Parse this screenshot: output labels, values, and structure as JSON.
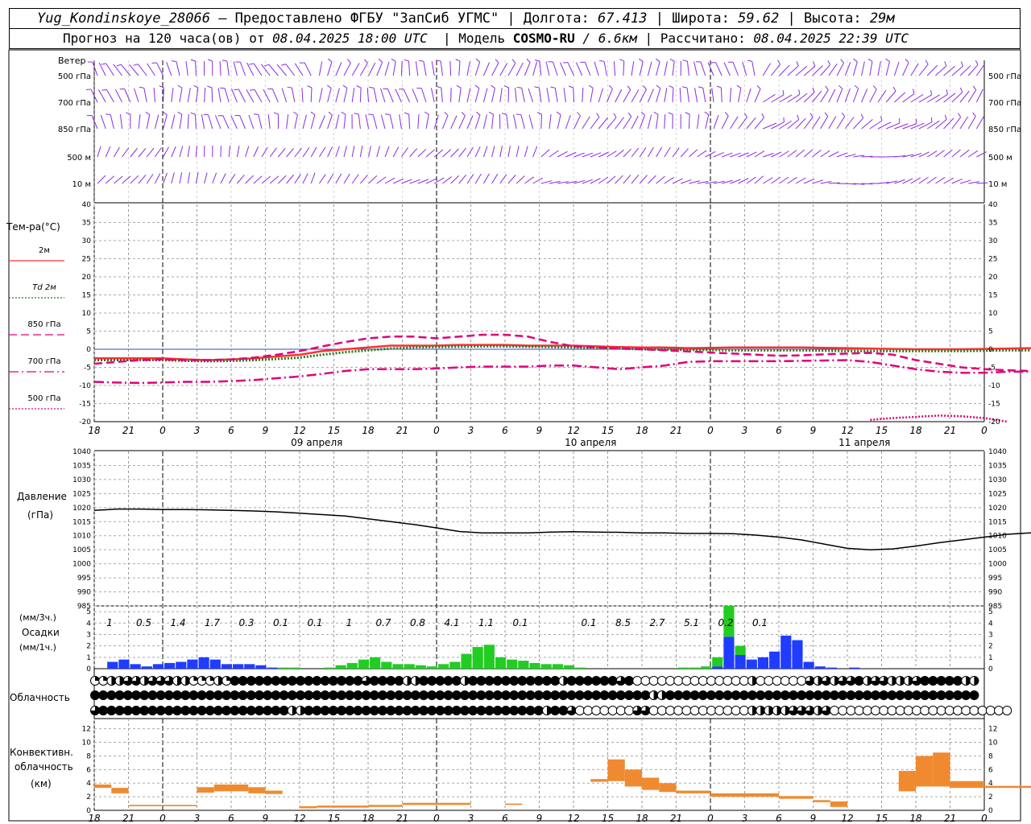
{
  "header": {
    "station": "Yug_Kondinskoye_28066",
    "provider": "– Предоставлено ФГБУ \"ЗапСиб УГМС\"",
    "lon_label": "Долгота:",
    "lon_value": "67.413",
    "lat_label": "Широта:",
    "lat_value": "59.62",
    "alt_label": "Высота:",
    "alt_value": "29м",
    "forecast_label": "Прогноз на 120 часа(ов) от",
    "forecast_start": "08.04.2025 18:00 UTC",
    "model_label": "Модель",
    "model_name": "COSMO-RU",
    "model_res": "/ 6.6км",
    "calc_label": "Рассчитано:",
    "calc_time": "08.04.2025 22:39 UTC"
  },
  "chart_data": {
    "x_ticks": [
      "18",
      "21",
      "0",
      "3",
      "6",
      "9",
      "12",
      "15",
      "18",
      "21",
      "0",
      "3",
      "6",
      "9",
      "12",
      "15",
      "18",
      "21",
      "0",
      "3",
      "6",
      "9",
      "12",
      "15",
      "18",
      "21",
      "0"
    ],
    "day_labels": [
      "09 апреля",
      "10 апреля",
      "11 апреля"
    ],
    "wind": {
      "title": "Ветер",
      "levels": [
        "500 гПа",
        "700 гПа",
        "850 гПа",
        "500 м",
        "10 м"
      ],
      "color": "#8a2be2"
    },
    "temperature": {
      "title": "Тем-ра(°С)",
      "type": "line",
      "ylim": [
        -20,
        40
      ],
      "y_ticks": [
        40,
        35,
        30,
        25,
        20,
        15,
        10,
        5,
        0,
        -5,
        -10,
        -15,
        -20
      ],
      "series": [
        {
          "name": "2м",
          "color": "#ff3030",
          "style": "solid",
          "values": [
            -2.5,
            -2.5,
            -2.5,
            -2.5,
            -2.8,
            -3,
            -2.8,
            -2.5,
            -2,
            -1.5,
            -0.5,
            0,
            0.5,
            1,
            1,
            1,
            1.2,
            1.2,
            1.2,
            1,
            1,
            1,
            0.8,
            0.6,
            0.5,
            0.5,
            0.3,
            0.4,
            0.5,
            0.5,
            0.5,
            0.5,
            0.4,
            0.3,
            0.2,
            0.1,
            0,
            0,
            0,
            0.1,
            0.2,
            0.3,
            0.3,
            0.3,
            0.4,
            0.4,
            0.4,
            0.5,
            0.5,
            0.3,
            -0.5,
            -1,
            -1.2,
            -1.3,
            -1.4
          ]
        },
        {
          "name": "Td 2м",
          "color": "#1f7a1f",
          "style": "dotted",
          "values": [
            -3,
            -3,
            -3,
            -3,
            -3.2,
            -3.3,
            -3.2,
            -3,
            -2.7,
            -2.3,
            -1.5,
            -0.8,
            -0.3,
            0.2,
            0.5,
            0.6,
            0.7,
            0.8,
            0.8,
            0.7,
            0.6,
            0.5,
            0.3,
            0.2,
            0,
            -0.1,
            -0.2,
            -0.2,
            -0.3,
            -0.3,
            -0.3,
            -0.3,
            -0.4,
            -0.5,
            -0.5,
            -0.5,
            -0.5,
            -0.5,
            -0.5,
            -0.4,
            -0.3,
            -0.3,
            -0.3,
            -0.2,
            -0.2,
            -0.2,
            -0.2,
            -0.2,
            -0.2,
            -0.5,
            -1.2,
            -1.8,
            -2,
            -2.3,
            -2.5
          ]
        },
        {
          "name": "850 гПа",
          "color": "#e0007a",
          "style": "dash",
          "values": [
            -4,
            -3.5,
            -3,
            -2.8,
            -3,
            -3,
            -2.8,
            -2.3,
            -1.5,
            -0.5,
            0.8,
            2,
            3,
            3.5,
            3.5,
            3,
            3.5,
            4,
            4,
            3.5,
            2,
            0.8,
            0.5,
            0.2,
            0,
            -0.3,
            -0.6,
            -0.9,
            -1.2,
            -1.5,
            -1.8,
            -1.7,
            -1.4,
            -1.2,
            -1,
            -1.5,
            -3,
            -4,
            -5,
            -5.5,
            -5.8,
            -6,
            -6.2,
            -6.2,
            -6.3,
            -6.4,
            -6.6,
            -6.8,
            -7,
            -6.8,
            -6.8,
            -7,
            -7,
            -7.2,
            -7.5
          ]
        },
        {
          "name": "700 гПа",
          "color": "#e0007a",
          "style": "dashdot",
          "values": [
            -9,
            -9.2,
            -9.3,
            -9.2,
            -9,
            -9,
            -8.8,
            -8.5,
            -8,
            -7.5,
            -6.8,
            -6,
            -5.5,
            -5.5,
            -5.5,
            -5.3,
            -5,
            -4.8,
            -4.8,
            -4.8,
            -4.5,
            -4.5,
            -5,
            -5.5,
            -5,
            -4.5,
            -3.5,
            -3.3,
            -3.3,
            -3.3,
            -3.3,
            -3.2,
            -3.1,
            -3,
            -3.5,
            -4.5,
            -5.5,
            -6.2,
            -6.5,
            -6.5,
            -6.2,
            -6.2,
            -6.5,
            -7,
            -7.5,
            -8,
            -8.5,
            -9,
            -9.5,
            -9.8,
            -10.2,
            -10.8,
            -10.2,
            -9.8,
            -10
          ]
        },
        {
          "name": "500 гПа",
          "color": "#e0007a",
          "style": "dotted",
          "values": [
            null,
            null,
            null,
            null,
            null,
            null,
            null,
            null,
            null,
            null,
            null,
            null,
            null,
            null,
            null,
            null,
            null,
            null,
            null,
            null,
            null,
            null,
            null,
            null,
            null,
            null,
            null,
            null,
            null,
            null,
            null,
            null,
            null,
            null,
            -19.5,
            -19,
            -18.7,
            -18.3,
            -18.5,
            -19,
            -20,
            null,
            null,
            null,
            null,
            null,
            null,
            null,
            null,
            -19.8,
            -19.2,
            -18.8,
            -18.7,
            -18.8,
            -19
          ]
        }
      ]
    },
    "pressure": {
      "title_line1": "Давление",
      "title_line2": "(гПа)",
      "type": "line",
      "ylim": [
        985,
        1040
      ],
      "y_ticks": [
        1040,
        1035,
        1030,
        1025,
        1020,
        1015,
        1010,
        1005,
        1000,
        995,
        990,
        985
      ],
      "values": [
        1019,
        1019.5,
        1019.5,
        1019.3,
        1019.3,
        1019.2,
        1019,
        1018.8,
        1018.5,
        1018,
        1017.5,
        1017,
        1016,
        1015,
        1014,
        1012.8,
        1011.5,
        1011,
        1011,
        1011,
        1011.3,
        1011.4,
        1011.3,
        1011.2,
        1011,
        1011,
        1010.8,
        1010.8,
        1010.7,
        1010.2,
        1009.5,
        1008.5,
        1007,
        1005.5,
        1005,
        1005.3,
        1006.3,
        1007.5,
        1008.5,
        1009.5,
        1010.5,
        1011,
        1011,
        1011,
        1011.2,
        1011.5,
        1011.8,
        1012,
        1011.8,
        1011.5,
        1011,
        1010.5,
        1009.5,
        1009.3,
        1009.5
      ]
    },
    "precipitation": {
      "label_3h": "(мм/3ч.)",
      "title": "Осадки",
      "label_1h": "(мм/1ч.)",
      "type": "bar",
      "ylim": [
        0,
        5
      ],
      "y_ticks": [
        5,
        4,
        3,
        2,
        1,
        0
      ],
      "totals_3h": [
        "1",
        "0.5",
        "1.4",
        "1.7",
        "0.3",
        "0.1",
        "0.1",
        "1",
        "0.7",
        "0.8",
        "4.1",
        "1.1",
        "0.1",
        "",
        "0.1",
        "8.5",
        "2.7",
        "5.1",
        "0.2",
        "0.1"
      ],
      "rain_color": "#22cc22",
      "snow_color": "#1f3cff",
      "hourly_total": [
        0,
        0.6,
        0.8,
        0.4,
        0.2,
        0.4,
        0.5,
        0.6,
        0.8,
        1.0,
        0.8,
        0.4,
        0.4,
        0.4,
        0.3,
        0.1,
        0.1,
        0.1,
        0,
        0,
        0.1,
        0.3,
        0.5,
        0.8,
        1.0,
        0.6,
        0.4,
        0.4,
        0.3,
        0.2,
        0.4,
        0.6,
        1.3,
        1.9,
        2.1,
        1.0,
        0.8,
        0.7,
        0.5,
        0.4,
        0.4,
        0.3,
        0.1,
        0,
        0,
        0,
        0,
        0,
        0,
        0,
        0,
        0.1,
        0.1,
        0.2,
        1.0,
        5.5,
        2.0,
        0.8,
        1.0,
        1.5,
        2.9,
        2.5,
        0.6,
        0.2,
        0.1,
        0,
        0.1
      ],
      "hourly_snow": [
        0,
        0.6,
        0.8,
        0.4,
        0.2,
        0.4,
        0.5,
        0.6,
        0.8,
        1.0,
        0.8,
        0.4,
        0.4,
        0.4,
        0.3,
        0.1,
        0,
        0,
        0,
        0,
        0,
        0,
        0,
        0,
        0,
        0,
        0,
        0,
        0,
        0,
        0,
        0,
        0,
        0,
        0,
        0,
        0,
        0,
        0,
        0,
        0,
        0,
        0,
        0,
        0,
        0,
        0,
        0,
        0,
        0,
        0,
        0,
        0,
        0,
        0.2,
        2.8,
        1.2,
        0.8,
        1.0,
        1.5,
        2.9,
        2.5,
        0.6,
        0.2,
        0.1,
        0,
        0.1
      ]
    },
    "cloudiness": {
      "title": "Облачность",
      "rows": [
        [
          1,
          1,
          2,
          2,
          3,
          3,
          2,
          3,
          3,
          3,
          2,
          2,
          1,
          1,
          1,
          2,
          1,
          4,
          4,
          4,
          4,
          4,
          4,
          4,
          4,
          4,
          4,
          4,
          4,
          4,
          4,
          4,
          4,
          3,
          4,
          4,
          4,
          4,
          2,
          2,
          4,
          4,
          4,
          4,
          4,
          2,
          4,
          4,
          4,
          4,
          4,
          4,
          4,
          4,
          4,
          4,
          4,
          2,
          4,
          4,
          4,
          4,
          4,
          4,
          3,
          4,
          0,
          0,
          0,
          0,
          0,
          0,
          0,
          0,
          0,
          0,
          0,
          0,
          0,
          0,
          2,
          0,
          0,
          0,
          0,
          0,
          0,
          3,
          2,
          3,
          2,
          3,
          3,
          4,
          2,
          3,
          3,
          2,
          2,
          2,
          3,
          4,
          4,
          4,
          4,
          4,
          2,
          2
        ],
        [
          4,
          4,
          4,
          4,
          4,
          4,
          4,
          4,
          4,
          4,
          4,
          4,
          4,
          4,
          4,
          4,
          4,
          4,
          4,
          4,
          4,
          4,
          4,
          4,
          4,
          4,
          4,
          4,
          4,
          4,
          4,
          4,
          4,
          4,
          4,
          4,
          4,
          4,
          4,
          4,
          4,
          4,
          4,
          4,
          4,
          4,
          4,
          4,
          4,
          4,
          4,
          4,
          4,
          4,
          4,
          4,
          4,
          4,
          4,
          4,
          4,
          4,
          4,
          4,
          4,
          4,
          4,
          4,
          2,
          2,
          4,
          4,
          4,
          4,
          4,
          4,
          4,
          4,
          4,
          4,
          4,
          4,
          4,
          4,
          4,
          4,
          4,
          4,
          4,
          4,
          4,
          4,
          4,
          4,
          4,
          4,
          4,
          4,
          4,
          4,
          4,
          4,
          4,
          4,
          4,
          4,
          4,
          4
        ],
        [
          3,
          4,
          4,
          4,
          4,
          4,
          4,
          4,
          4,
          4,
          4,
          4,
          4,
          4,
          4,
          4,
          4,
          4,
          4,
          4,
          4,
          4,
          4,
          4,
          2,
          2,
          4,
          4,
          4,
          4,
          4,
          4,
          4,
          4,
          4,
          4,
          4,
          4,
          4,
          4,
          4,
          4,
          4,
          4,
          4,
          4,
          4,
          4,
          4,
          4,
          4,
          4,
          4,
          4,
          4,
          2,
          4,
          4,
          3,
          0,
          0,
          0,
          0,
          0,
          0,
          0,
          3,
          3,
          0,
          0,
          0,
          0,
          0,
          0,
          0,
          0,
          0,
          0,
          0,
          0,
          2,
          2,
          2,
          2,
          2,
          3,
          3,
          3,
          2,
          3,
          0,
          0,
          0,
          0,
          0,
          0,
          0,
          0,
          0,
          0,
          0,
          0,
          0,
          0,
          0,
          0,
          0,
          0,
          0,
          0,
          0,
          0
        ]
      ]
    },
    "convective": {
      "title_line1": "Конвективн.",
      "title_line2": "облачность",
      "title_line3": "(км)",
      "type": "bar",
      "ylim": [
        0,
        13
      ],
      "y_ticks": [
        12,
        10,
        8,
        6,
        4,
        2,
        0
      ],
      "color": "#f08a30",
      "segments": [
        [
          0,
          0.5,
          3.3,
          3.8
        ],
        [
          0.5,
          1,
          2.5,
          3.3
        ],
        [
          1,
          3,
          0.6,
          0.8
        ],
        [
          3,
          3.5,
          2.6,
          3.4
        ],
        [
          3.5,
          4.5,
          2.8,
          3.8
        ],
        [
          4.5,
          5,
          2.5,
          3.4
        ],
        [
          5,
          5.5,
          2.4,
          2.9
        ],
        [
          6,
          6.5,
          0.3,
          0.6
        ],
        [
          6.5,
          8,
          0.4,
          0.7
        ],
        [
          8,
          9,
          0.5,
          0.8
        ],
        [
          9,
          11,
          0.8,
          1.1
        ],
        [
          12,
          12.5,
          0.8,
          1.0
        ],
        [
          14.5,
          15,
          4.2,
          4.6
        ],
        [
          15,
          15.5,
          4.3,
          7.5
        ],
        [
          15.5,
          16,
          3.5,
          6.0
        ],
        [
          16,
          16.5,
          3,
          4.8
        ],
        [
          16.5,
          17,
          2.7,
          4.0
        ],
        [
          17,
          18,
          2.5,
          2.9
        ],
        [
          18,
          20,
          2.0,
          2.5
        ],
        [
          20,
          21,
          1.7,
          2.1
        ],
        [
          21,
          21.5,
          1.2,
          1.5
        ],
        [
          21.5,
          22,
          0.5,
          1.3
        ],
        [
          23.5,
          24,
          2.8,
          5.8
        ],
        [
          24,
          24.5,
          3.5,
          8.0
        ],
        [
          24.5,
          25,
          3.5,
          8.5
        ],
        [
          25,
          26,
          3.3,
          4.3
        ],
        [
          26,
          28,
          3.3,
          3.6
        ],
        [
          28,
          30,
          3.3,
          3.6
        ],
        [
          30,
          30.5,
          4.2,
          5.0
        ],
        [
          30.5,
          31,
          3.5,
          5.5
        ],
        [
          31,
          31.5,
          4.2,
          6.0
        ],
        [
          31.5,
          32,
          3.0,
          6.2
        ],
        [
          32,
          33,
          3.0,
          6.8
        ],
        [
          33,
          33.5,
          3.5,
          6.5
        ],
        [
          33.5,
          34,
          3.6,
          5.7
        ],
        [
          34,
          34.5,
          4.0,
          6.5
        ],
        [
          34.5,
          35,
          4.3,
          4.8
        ],
        [
          35,
          35.5,
          0.7,
          1.1
        ],
        [
          36,
          36.5,
          3.5,
          6.7
        ],
        [
          36.5,
          37,
          3.5,
          5.5
        ],
        [
          37,
          37.5,
          3.8,
          4.5
        ],
        [
          37.5,
          38,
          4.0,
          5.5
        ],
        [
          38,
          38.5,
          0.6,
          0.8
        ],
        [
          39,
          39.5,
          0.6,
          0.9
        ],
        [
          40,
          40.5,
          0.5,
          0.8
        ],
        [
          42,
          43,
          0.5,
          0.7
        ],
        [
          44,
          45,
          0.5,
          0.7
        ],
        [
          45,
          46,
          0.4,
          0.6
        ],
        [
          53,
          54,
          4.2,
          4.8
        ],
        [
          54,
          55,
          4.4,
          4.8
        ],
        [
          55,
          56,
          4.6,
          5.0
        ],
        [
          56,
          57,
          4.2,
          4.8
        ],
        [
          57,
          58,
          4.1,
          4.6
        ],
        [
          63.5,
          64,
          1.9,
          2.3
        ]
      ]
    }
  }
}
